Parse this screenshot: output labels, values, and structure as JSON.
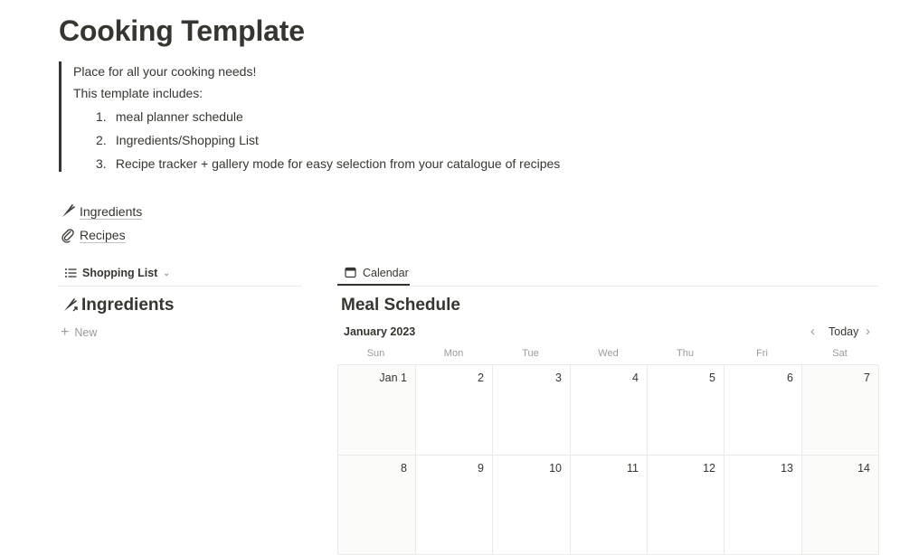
{
  "page": {
    "title": "Cooking Template"
  },
  "callout": {
    "line1": "Place for all your cooking needs!",
    "line2": "This template includes:",
    "items": [
      {
        "num": "1.",
        "text": "meal planner schedule"
      },
      {
        "num": "2.",
        "text": "Ingredients/Shopping List"
      },
      {
        "num": "3.",
        "text": "Recipe tracker + gallery mode for easy selection from your catalogue of recipes"
      }
    ]
  },
  "links": [
    {
      "label": "Ingredients",
      "icon": "carrot-icon"
    },
    {
      "label": "Recipes",
      "icon": "paperclip-icon"
    }
  ],
  "left_db": {
    "view_label": "Shopping List",
    "title": "Ingredients",
    "new_label": "New"
  },
  "right_db": {
    "view_label": "Calendar",
    "title": "Meal Schedule",
    "month": "January 2023",
    "today_label": "Today",
    "weekdays": [
      "Sun",
      "Mon",
      "Tue",
      "Wed",
      "Thu",
      "Fri",
      "Sat"
    ],
    "weeks": [
      [
        "Jan 1",
        "2",
        "3",
        "4",
        "5",
        "6",
        "7"
      ],
      [
        "8",
        "9",
        "10",
        "11",
        "12",
        "13",
        "14"
      ]
    ]
  },
  "colors": {
    "text": "#37352f",
    "muted": "#9b9a97",
    "border": "#e9e9e7",
    "weekend_bg": "#fbfbfa"
  }
}
